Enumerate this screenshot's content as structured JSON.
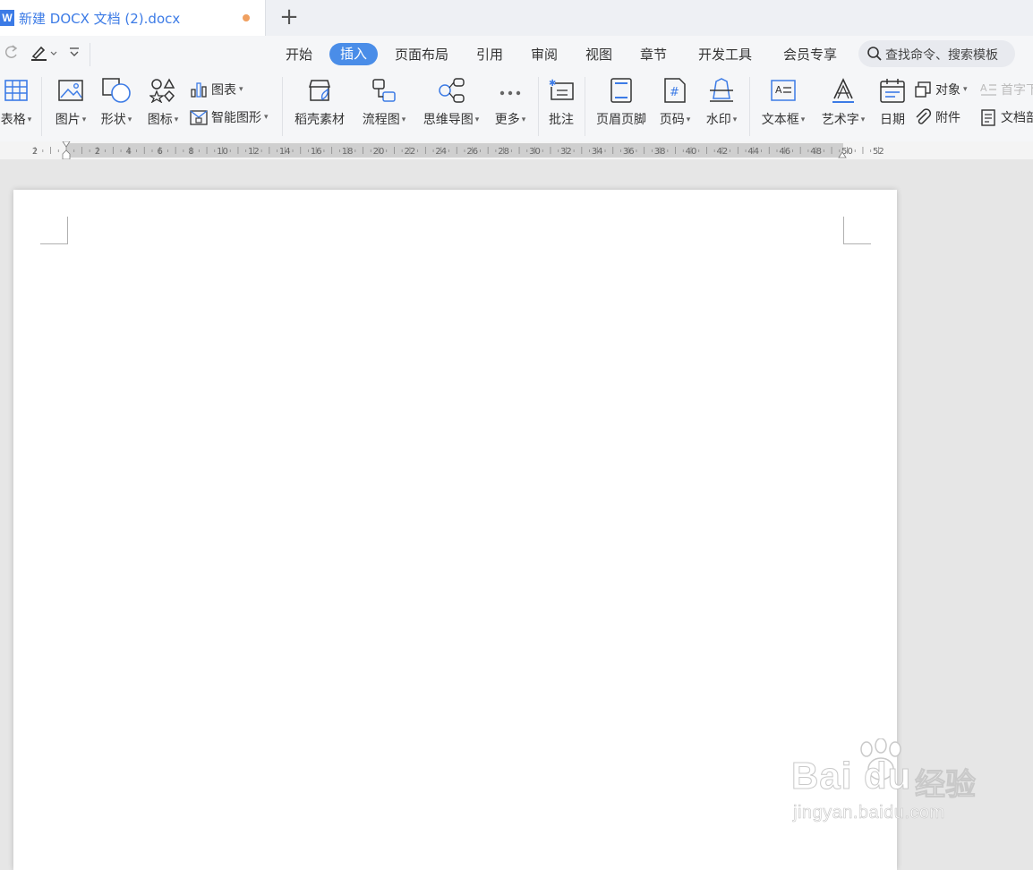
{
  "tab": {
    "icon_letter": "W",
    "title": "新建 DOCX 文档 (2).docx",
    "new_tab": "+"
  },
  "menu": {
    "items": [
      "开始",
      "插入",
      "页面布局",
      "引用",
      "审阅",
      "视图",
      "章节",
      "开发工具",
      "会员专享"
    ],
    "active_index": 1,
    "search_placeholder": "查找命令、搜索模板"
  },
  "ribbon": {
    "table": "表格",
    "picture": "图片",
    "shape": "形状",
    "icon": "图标",
    "chart": "图表",
    "smartart": "智能图形",
    "daoke": "稻壳素材",
    "flowchart": "流程图",
    "mindmap": "思维导图",
    "more": "更多",
    "comment": "批注",
    "header_footer": "页眉页脚",
    "page_number": "页码",
    "watermark": "水印",
    "textbox": "文本框",
    "wordart": "艺术字",
    "date": "日期",
    "object": "对象",
    "attachment": "附件",
    "dropcap": "首字下沉",
    "doc_parts": "文档部件"
  },
  "ruler": {
    "labels": [
      "2",
      "2",
      "4",
      "6",
      "8",
      "10",
      "12",
      "14",
      "16",
      "18",
      "20",
      "22",
      "24",
      "26",
      "28",
      "30",
      "32",
      "34",
      "36",
      "38",
      "40",
      "42",
      "44",
      "46",
      "48",
      "50",
      "52"
    ]
  },
  "watermark": {
    "brand": "Bai du",
    "cn": "经验",
    "url": "jingyan.baidu.com"
  },
  "colors": {
    "accent": "#4a8de8",
    "tab_title": "#3c7be6",
    "unsaved_dot": "#f0a060"
  }
}
